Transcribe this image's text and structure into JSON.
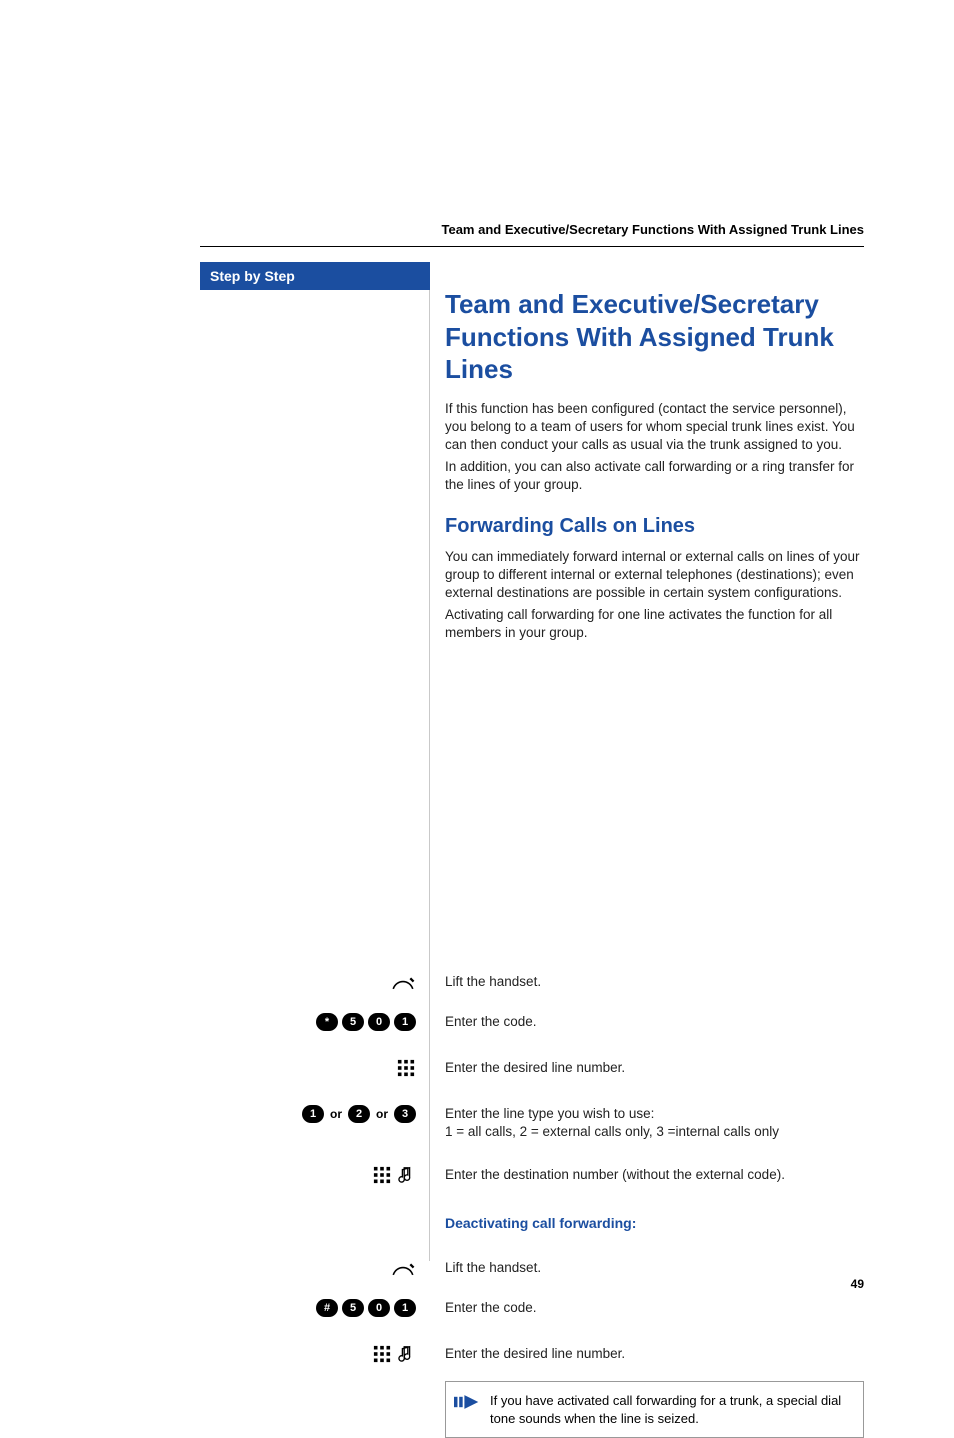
{
  "runningHeader": "Team and Executive/Secretary Functions With Assigned Trunk Lines",
  "stepByStepLabel": "Step by Step",
  "title": "Team and Executive/Secretary Functions With Assigned Trunk Lines",
  "intro1": "If this function has been configured (contact the service personnel), you belong to a team of users for whom special trunk lines exist. You can then conduct your calls as usual via the trunk assigned to you.",
  "intro2": "In addition, you can also activate call forwarding or a ring transfer for the lines of your group.",
  "section1Title": "Forwarding Calls on Lines",
  "section1Body1": "You can immediately forward internal or external calls on lines of your group to different internal or external telephones (destinations); even external destinations are possible in certain system configurations.",
  "section1Body2": "Activating call forwarding for one line activates the function for all members in your group.",
  "steps": {
    "liftHandset": "Lift the handset.",
    "codeActivate": {
      "keys": [
        "*",
        "5",
        "0",
        "1"
      ],
      "text": "Enter the code."
    },
    "enterLine": "Enter the desired line number.",
    "lineTypeKeys": {
      "k1": "1",
      "or1": "or",
      "k2": "2",
      "or2": "or",
      "k3": "3"
    },
    "lineTypeText": "Enter the line type you wish to use:",
    "lineTypeSub": "1 = all calls, 2 = external calls only, 3 =internal calls only",
    "enterDest": "Enter the destination number (without the external code).",
    "deactHeading": "Deactivating call forwarding:",
    "codeDeactivate": {
      "keys": [
        "#",
        "5",
        "0",
        "1"
      ],
      "text": "Enter the code."
    }
  },
  "noteText": "If you have activated call forwarding for a trunk, a special dial tone sounds when the line is seized.",
  "pageNumber": "49"
}
